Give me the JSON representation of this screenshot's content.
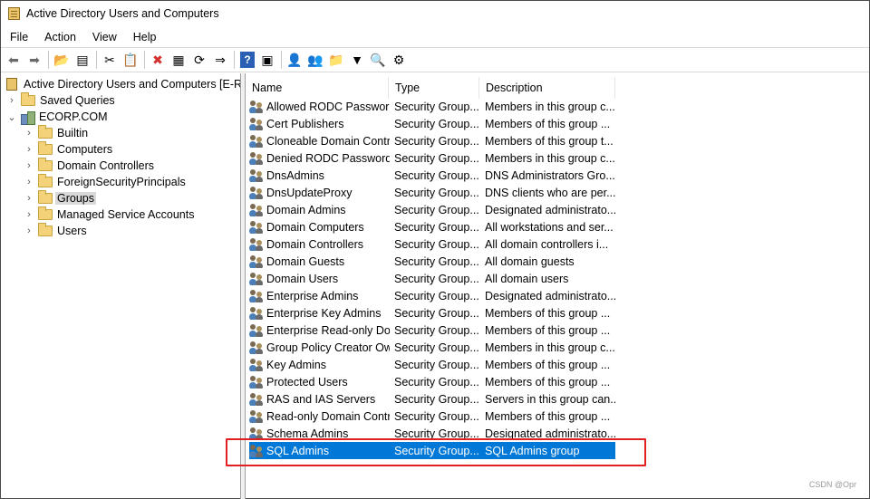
{
  "window": {
    "title": "Active Directory Users and Computers"
  },
  "menu": [
    "File",
    "Action",
    "View",
    "Help"
  ],
  "toolbar": {
    "buttons": [
      {
        "icon": "back-arrow-icon",
        "glyph": "⬅"
      },
      {
        "icon": "forward-arrow-icon",
        "glyph": "➡"
      },
      {
        "icon": "up-folder-icon",
        "glyph": "📂"
      },
      {
        "icon": "show-console-tree-icon",
        "glyph": "▤"
      },
      {
        "icon": "cut-icon",
        "glyph": "✂"
      },
      {
        "icon": "copy-icon",
        "glyph": "📋"
      },
      {
        "icon": "delete-icon",
        "glyph": "✖"
      },
      {
        "icon": "properties-icon",
        "glyph": "▦"
      },
      {
        "icon": "refresh-icon",
        "glyph": "⟳"
      },
      {
        "icon": "export-list-icon",
        "glyph": "⇒"
      },
      {
        "icon": "help-icon",
        "glyph": "?"
      },
      {
        "icon": "action-pane-icon",
        "glyph": "▣"
      },
      {
        "icon": "new-user-icon",
        "glyph": "👤"
      },
      {
        "icon": "new-group-icon",
        "glyph": "👥"
      },
      {
        "icon": "new-ou-icon",
        "glyph": "📁"
      },
      {
        "icon": "filter-icon",
        "glyph": "▼"
      },
      {
        "icon": "find-icon",
        "glyph": "🔍"
      },
      {
        "icon": "add-to-group-icon",
        "glyph": "⚙"
      }
    ]
  },
  "tree": {
    "root": "Active Directory Users and Computers [E-RDC",
    "saved_queries": "Saved Queries",
    "domain": "ECORP.COM",
    "children": [
      "Builtin",
      "Computers",
      "Domain Controllers",
      "ForeignSecurityPrincipals",
      "Groups",
      "Managed Service Accounts",
      "Users"
    ],
    "selected": "Groups"
  },
  "list": {
    "columns": [
      "Name",
      "Type",
      "Description"
    ],
    "rows": [
      {
        "name": "Allowed RODC Password Replication Group",
        "type": "Security Group...",
        "description": "Members in this group c..."
      },
      {
        "name": "Cert Publishers",
        "type": "Security Group...",
        "description": "Members of this group ..."
      },
      {
        "name": "Cloneable Domain Controllers",
        "type": "Security Group...",
        "description": "Members of this group t..."
      },
      {
        "name": "Denied RODC Password Replication Group",
        "type": "Security Group...",
        "description": "Members in this group c..."
      },
      {
        "name": "DnsAdmins",
        "type": "Security Group...",
        "description": "DNS Administrators Gro..."
      },
      {
        "name": "DnsUpdateProxy",
        "type": "Security Group...",
        "description": "DNS clients who are per..."
      },
      {
        "name": "Domain Admins",
        "type": "Security Group...",
        "description": "Designated administrato..."
      },
      {
        "name": "Domain Computers",
        "type": "Security Group...",
        "description": "All workstations and ser..."
      },
      {
        "name": "Domain Controllers",
        "type": "Security Group...",
        "description": "All domain controllers i..."
      },
      {
        "name": "Domain Guests",
        "type": "Security Group...",
        "description": "All domain guests"
      },
      {
        "name": "Domain Users",
        "type": "Security Group...",
        "description": "All domain users"
      },
      {
        "name": "Enterprise Admins",
        "type": "Security Group...",
        "description": "Designated administrato..."
      },
      {
        "name": "Enterprise Key Admins",
        "type": "Security Group...",
        "description": "Members of this group ..."
      },
      {
        "name": "Enterprise Read-only Domain Controllers",
        "type": "Security Group...",
        "description": "Members of this group ..."
      },
      {
        "name": "Group Policy Creator Owners",
        "type": "Security Group...",
        "description": "Members in this group c..."
      },
      {
        "name": "Key Admins",
        "type": "Security Group...",
        "description": "Members of this group ..."
      },
      {
        "name": "Protected Users",
        "type": "Security Group...",
        "description": "Members of this group ..."
      },
      {
        "name": "RAS and IAS Servers",
        "type": "Security Group...",
        "description": "Servers in this group can..."
      },
      {
        "name": "Read-only Domain Controllers",
        "type": "Security Group...",
        "description": "Members of this group ..."
      },
      {
        "name": "Schema Admins",
        "type": "Security Group...",
        "description": "Designated administrato..."
      },
      {
        "name": "SQL Admins",
        "type": "Security Group...",
        "description": "SQL Admins group"
      }
    ],
    "selected_index": 20
  },
  "colors": {
    "selection": "#0078d7",
    "highlight_box": "#e02020"
  },
  "watermark": "CSDN @Opr"
}
